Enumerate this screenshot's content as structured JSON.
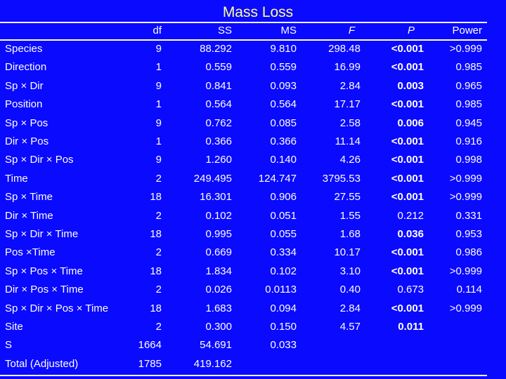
{
  "title": "Mass Loss",
  "colors": {
    "background": "#0a0aff",
    "title": "#ffff99",
    "text": "#ffffff"
  },
  "columns": [
    "df",
    "SS",
    "MS",
    "F",
    "P",
    "Power"
  ],
  "rows": [
    {
      "source": "Species",
      "df": "9",
      "ss": "88.292",
      "ms": "9.810",
      "f": "298.48",
      "p": "<0.001",
      "p_bold": true,
      "power": ">0.999"
    },
    {
      "source": "Direction",
      "df": "1",
      "ss": "0.559",
      "ms": "0.559",
      "f": "16.99",
      "p": "<0.001",
      "p_bold": true,
      "power": "0.985"
    },
    {
      "source": "Sp × Dir",
      "df": "9",
      "ss": "0.841",
      "ms": "0.093",
      "f": "2.84",
      "p": "0.003",
      "p_bold": true,
      "power": "0.965"
    },
    {
      "source": "Position",
      "df": "1",
      "ss": "0.564",
      "ms": "0.564",
      "f": "17.17",
      "p": "<0.001",
      "p_bold": true,
      "power": "0.985"
    },
    {
      "source": "Sp × Pos",
      "df": "9",
      "ss": "0.762",
      "ms": "0.085",
      "f": "2.58",
      "p": "0.006",
      "p_bold": true,
      "power": "0.945"
    },
    {
      "source": "Dir × Pos",
      "df": "1",
      "ss": "0.366",
      "ms": "0.366",
      "f": "11.14",
      "p": "<0.001",
      "p_bold": true,
      "power": "0.916"
    },
    {
      "source": "Sp × Dir × Pos",
      "df": "9",
      "ss": "1.260",
      "ms": "0.140",
      "f": "4.26",
      "p": "<0.001",
      "p_bold": true,
      "power": "0.998"
    },
    {
      "source": "Time",
      "df": "2",
      "ss": "249.495",
      "ms": "124.747",
      "f": "3795.53",
      "p": "<0.001",
      "p_bold": true,
      "power": ">0.999"
    },
    {
      "source": "Sp × Time",
      "df": "18",
      "ss": "16.301",
      "ms": "0.906",
      "f": "27.55",
      "p": "<0.001",
      "p_bold": true,
      "power": ">0.999"
    },
    {
      "source": "Dir × Time",
      "df": "2",
      "ss": "0.102",
      "ms": "0.051",
      "f": "1.55",
      "p": "0.212",
      "p_bold": false,
      "power": "0.331"
    },
    {
      "source": "Sp × Dir × Time",
      "df": "18",
      "ss": "0.995",
      "ms": "0.055",
      "f": "1.68",
      "p": "0.036",
      "p_bold": true,
      "power": "0.953"
    },
    {
      "source": "Pos ×Time",
      "df": "2",
      "ss": "0.669",
      "ms": "0.334",
      "f": "10.17",
      "p": "<0.001",
      "p_bold": true,
      "power": "0.986"
    },
    {
      "source": "Sp × Pos × Time",
      "df": "18",
      "ss": "1.834",
      "ms": "0.102",
      "f": "3.10",
      "p": "<0.001",
      "p_bold": true,
      "power": ">0.999"
    },
    {
      "source": "Dir × Pos × Time",
      "df": "2",
      "ss": "0.026",
      "ms": "0.0113",
      "f": "0.40",
      "p": "0.673",
      "p_bold": false,
      "power": "0.114"
    },
    {
      "source": "Sp × Dir  × Pos × Time",
      "df": "18",
      "ss": "1.683",
      "ms": "0.094",
      "f": "2.84",
      "p": "<0.001",
      "p_bold": true,
      "power": ">0.999"
    },
    {
      "source": "Site",
      "df": "2",
      "ss": "0.300",
      "ms": "0.150",
      "f": "4.57",
      "p": "0.011",
      "p_bold": true,
      "power": ""
    },
    {
      "source": "S",
      "df": "1664",
      "ss": "54.691",
      "ms": "0.033",
      "f": "",
      "p": "",
      "p_bold": false,
      "power": ""
    },
    {
      "source": "Total (Adjusted)",
      "df": "1785",
      "ss": "419.162",
      "ms": "",
      "f": "",
      "p": "",
      "p_bold": false,
      "power": ""
    }
  ]
}
